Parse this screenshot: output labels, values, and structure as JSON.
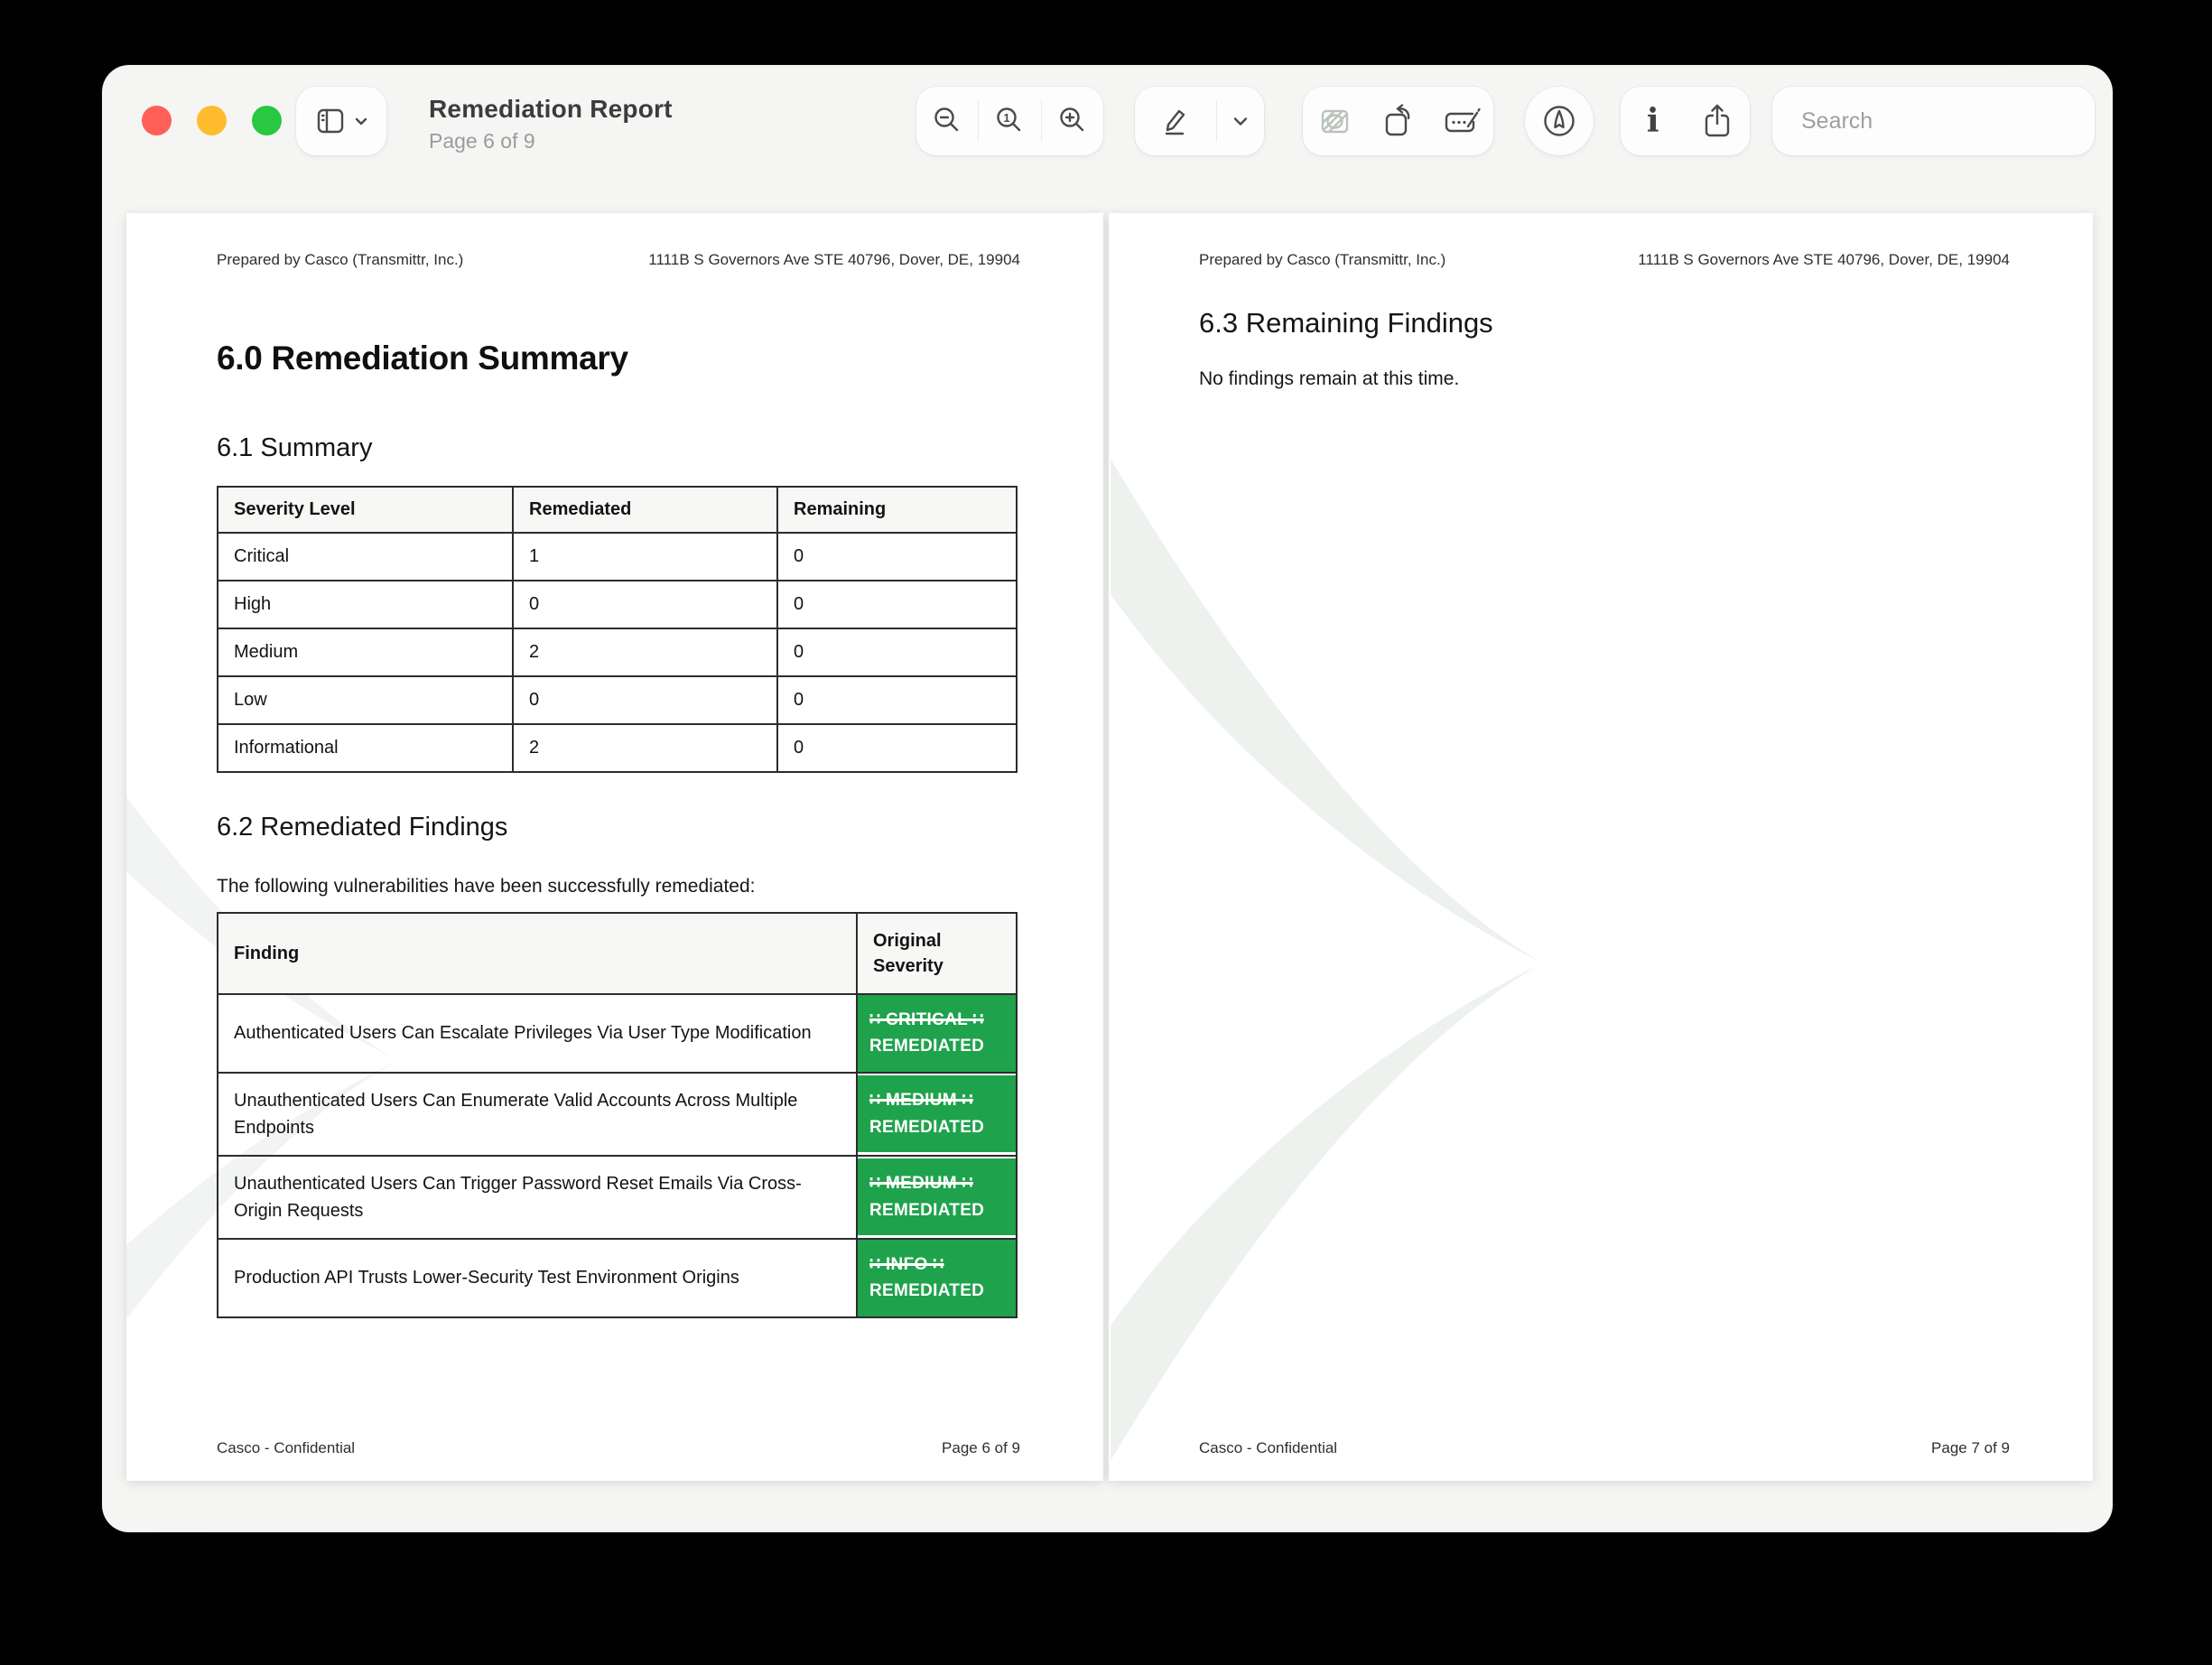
{
  "window": {
    "title": "Remediation Report",
    "subtitle": "Page 6 of 9",
    "search": {
      "placeholder": "Search"
    }
  },
  "doc": {
    "header_left": "Prepared by Casco (Transmittr, Inc.)",
    "header_right": "1111B S Governors Ave STE 40796, Dover, DE, 19904",
    "footer_brand": "Casco - Confidential",
    "page_left": {
      "footer_page": "Page 6 of 9",
      "h1": "6.0 Remediation Summary",
      "summary": {
        "heading": "6.1 Summary",
        "columns": [
          "Severity Level",
          "Remediated",
          "Remaining"
        ],
        "rows": [
          [
            "Critical",
            "1",
            "0"
          ],
          [
            "High",
            "0",
            "0"
          ],
          [
            "Medium",
            "2",
            "0"
          ],
          [
            "Low",
            "0",
            "0"
          ],
          [
            "Informational",
            "2",
            "0"
          ]
        ]
      },
      "remediated": {
        "heading": "6.2 Remediated Findings",
        "intro": "The following vulnerabilities have been successfully remediated:",
        "columns": [
          "Finding",
          "Original Severity"
        ],
        "rows": [
          {
            "finding": "Authenticated Users Can Escalate Privileges Via User Type Modification",
            "badge_top": "∷ CRITICAL ∷",
            "badge_bottom": "REMEDIATED"
          },
          {
            "finding": "Unauthenticated Users Can Enumerate Valid Accounts Across Multiple Endpoints",
            "badge_top": "∷ MEDIUM ∷",
            "badge_bottom": "REMEDIATED"
          },
          {
            "finding": "Unauthenticated Users Can Trigger Password Reset Emails Via Cross-Origin Requests",
            "badge_top": "∷ MEDIUM ∷",
            "badge_bottom": "REMEDIATED"
          },
          {
            "finding": "Production API Trusts Lower-Security Test Environment Origins",
            "badge_top": "∷ INFO ∷",
            "badge_bottom": "REMEDIATED"
          }
        ]
      }
    },
    "page_right": {
      "footer_page": "Page 7 of 9",
      "heading": "6.3 Remaining Findings",
      "body": "No findings remain at this time."
    }
  },
  "colors": {
    "badge_green": "#1fa24c",
    "traffic_red": "#ff5f57",
    "traffic_yellow": "#febc2e",
    "traffic_green": "#28c840",
    "watermark": "#eef2ef"
  }
}
